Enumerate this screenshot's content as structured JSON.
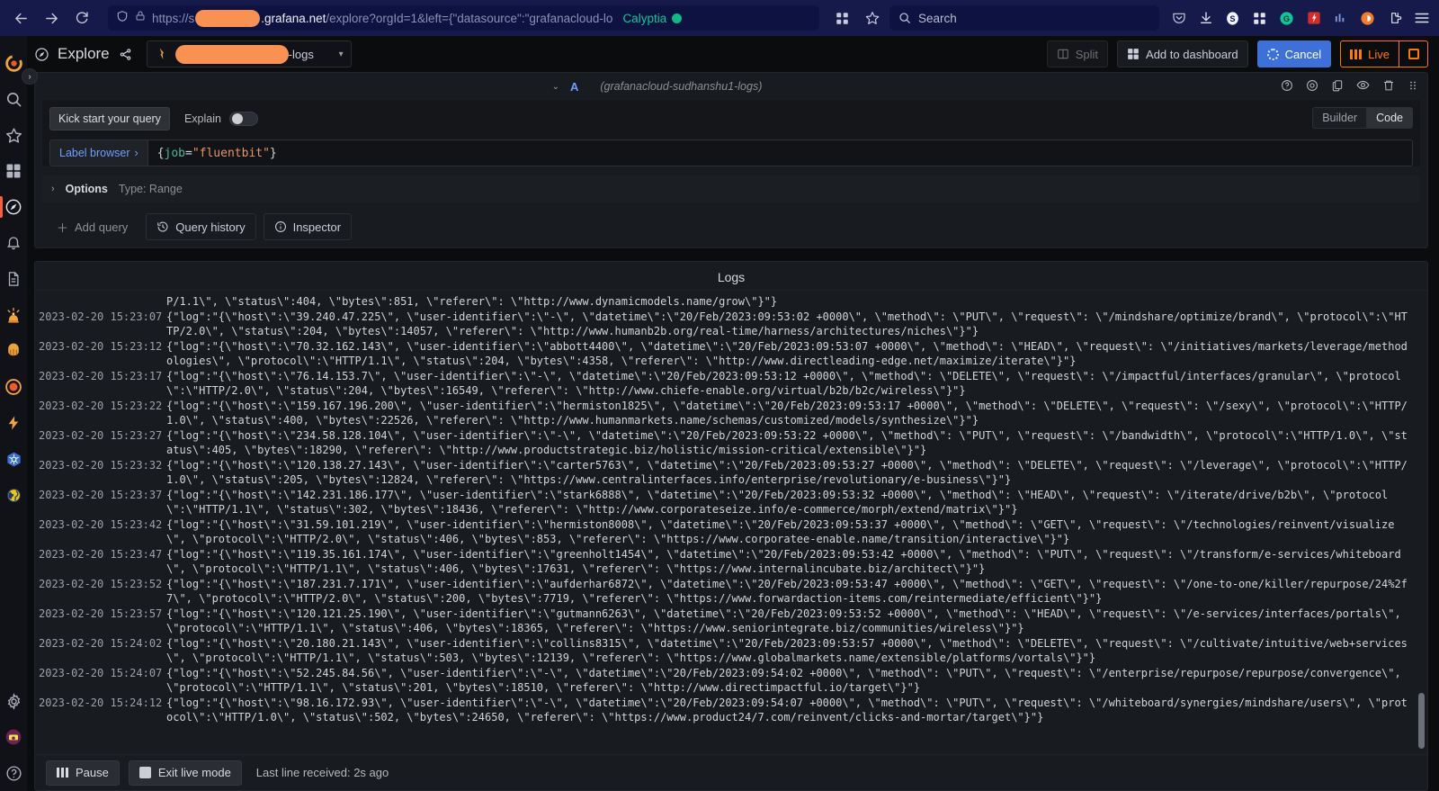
{
  "browser": {
    "url_scheme": "https://s",
    "url_domain": ".grafana.net",
    "url_path": "/explore?orgId=1&left={\"datasource\":\"grafanacloud-lo",
    "profile_label": "Calyptia",
    "search_placeholder": "Search",
    "icons": [
      "back-arrow-icon",
      "forward-arrow-icon",
      "reload-icon",
      "shield-icon",
      "lock-icon",
      "bookmark-star-icon",
      "search-icon"
    ],
    "extensions": [
      "pocket-icon",
      "download-icon",
      "stripe-icon",
      "apps-grid-icon",
      "grammarly-icon",
      "lastpass-icon",
      "metrics-icon",
      "firefox-container-icon",
      "extensions-icon",
      "menu-icon"
    ]
  },
  "sidebar": {
    "items": [
      {
        "name": "grafana-logo-icon",
        "label": "Grafana"
      },
      {
        "name": "search-icon",
        "label": "Search"
      },
      {
        "name": "star-icon",
        "label": "Starred"
      },
      {
        "name": "dashboards-icon",
        "label": "Dashboards"
      },
      {
        "name": "explore-compass-icon",
        "label": "Explore",
        "active": true
      },
      {
        "name": "bell-icon",
        "label": "Alerting"
      },
      {
        "name": "document-icon",
        "label": "Reporting"
      },
      {
        "name": "siren-icon",
        "label": "OnCall"
      },
      {
        "name": "brain-icon",
        "label": "Machine Learning"
      },
      {
        "name": "incident-icon",
        "label": "Incident"
      },
      {
        "name": "lightning-icon",
        "label": "k6 Performance"
      },
      {
        "name": "kubernetes-icon",
        "label": "Kubernetes Monitoring"
      },
      {
        "name": "globe-icon",
        "label": "Synthetic Monitoring"
      }
    ],
    "bottom_items": [
      {
        "name": "gear-icon",
        "label": "Configuration"
      },
      {
        "name": "avatar-icon",
        "label": "Profile"
      },
      {
        "name": "help-icon",
        "label": "Help"
      }
    ],
    "expander_glyph": "›"
  },
  "toolbar": {
    "title": "Explore",
    "share_icon": "share-icon",
    "explore_icon": "compass-icon",
    "datasource_suffix": "-logs",
    "split_label": "Split",
    "add_to_dashboard_label": "Add to dashboard",
    "cancel_label": "Cancel",
    "live_label": "Live"
  },
  "query": {
    "letter": "A",
    "datasource": "(grafanacloud-sudhanshu1-logs)",
    "kick_start_label": "Kick start your query",
    "explain_label": "Explain",
    "builder_label": "Builder",
    "code_label": "Code",
    "label_browser_label": "Label browser",
    "label_browser_chevron": "›",
    "expr_brace_open": "{",
    "expr_key": "job",
    "expr_op": "=",
    "expr_value": "\"fluentbit\"",
    "expr_brace_close": "}",
    "options_chevron": "›",
    "options_label": "Options",
    "options_value": "Type: Range",
    "add_query_label": "Add query",
    "query_history_label": "Query history",
    "inspector_label": "Inspector",
    "row_icons": [
      "help-circle-icon",
      "target-icon",
      "copy-icon",
      "eye-icon",
      "trash-icon",
      "drag-handle-icon"
    ]
  },
  "logs": {
    "title": "Logs",
    "pause_label": "Pause",
    "exit_live_label": "Exit live mode",
    "last_line_label": "Last line received: 2s ago",
    "rows": [
      {
        "ts": "",
        "msg": "P/1.1\\\", \\\"status\\\":404, \\\"bytes\\\":851, \\\"referer\\\": \\\"http://www.dynamicmodels.name/grow\\\"}\"}"
      },
      {
        "ts": "2023-02-20 15:23:07",
        "msg": "{\"log\":\"{\\\"host\\\":\\\"39.240.47.225\\\", \\\"user-identifier\\\":\\\"-\\\", \\\"datetime\\\":\\\"20/Feb/2023:09:53:02 +0000\\\", \\\"method\\\": \\\"PUT\\\", \\\"request\\\": \\\"/mindshare/optimize/brand\\\", \\\"protocol\\\":\\\"HTTP/2.0\\\", \\\"status\\\":204, \\\"bytes\\\":14057, \\\"referer\\\": \\\"http://www.humanb2b.org/real-time/harness/architectures/niches\\\"}\"}"
      },
      {
        "ts": "2023-02-20 15:23:12",
        "msg": "{\"log\":\"{\\\"host\\\":\\\"70.32.162.143\\\", \\\"user-identifier\\\":\\\"abbott4400\\\", \\\"datetime\\\":\\\"20/Feb/2023:09:53:07 +0000\\\", \\\"method\\\": \\\"HEAD\\\", \\\"request\\\": \\\"/initiatives/markets/leverage/methodologies\\\", \\\"protocol\\\":\\\"HTTP/1.1\\\", \\\"status\\\":204, \\\"bytes\\\":4358, \\\"referer\\\": \\\"http://www.directleading-edge.net/maximize/iterate\\\"}\"}"
      },
      {
        "ts": "2023-02-20 15:23:17",
        "msg": "{\"log\":\"{\\\"host\\\":\\\"76.14.153.7\\\", \\\"user-identifier\\\":\\\"-\\\", \\\"datetime\\\":\\\"20/Feb/2023:09:53:12 +0000\\\", \\\"method\\\": \\\"DELETE\\\", \\\"request\\\": \\\"/impactful/interfaces/granular\\\", \\\"protocol\\\":\\\"HTTP/2.0\\\", \\\"status\\\":204, \\\"bytes\\\":16549, \\\"referer\\\": \\\"http://www.chiefe-enable.org/virtual/b2b/b2c/wireless\\\"}\"}"
      },
      {
        "ts": "2023-02-20 15:23:22",
        "msg": "{\"log\":\"{\\\"host\\\":\\\"159.167.196.200\\\", \\\"user-identifier\\\":\\\"hermiston1825\\\", \\\"datetime\\\":\\\"20/Feb/2023:09:53:17 +0000\\\", \\\"method\\\": \\\"DELETE\\\", \\\"request\\\": \\\"/sexy\\\", \\\"protocol\\\":\\\"HTTP/1.0\\\", \\\"status\\\":400, \\\"bytes\\\":22526, \\\"referer\\\": \\\"http://www.humanmarkets.name/schemas/customized/models/synthesize\\\"}\"}"
      },
      {
        "ts": "2023-02-20 15:23:27",
        "msg": "{\"log\":\"{\\\"host\\\":\\\"234.58.128.104\\\", \\\"user-identifier\\\":\\\"-\\\", \\\"datetime\\\":\\\"20/Feb/2023:09:53:22 +0000\\\", \\\"method\\\": \\\"PUT\\\", \\\"request\\\": \\\"/bandwidth\\\", \\\"protocol\\\":\\\"HTTP/1.0\\\", \\\"status\\\":405, \\\"bytes\\\":18290, \\\"referer\\\": \\\"http://www.productstrategic.biz/holistic/mission-critical/extensible\\\"}\"}"
      },
      {
        "ts": "2023-02-20 15:23:32",
        "msg": "{\"log\":\"{\\\"host\\\":\\\"120.138.27.143\\\", \\\"user-identifier\\\":\\\"carter5763\\\", \\\"datetime\\\":\\\"20/Feb/2023:09:53:27 +0000\\\", \\\"method\\\": \\\"DELETE\\\", \\\"request\\\": \\\"/leverage\\\", \\\"protocol\\\":\\\"HTTP/1.0\\\", \\\"status\\\":205, \\\"bytes\\\":12824, \\\"referer\\\": \\\"https://www.centralinterfaces.info/enterprise/revolutionary/e-business\\\"}\"}"
      },
      {
        "ts": "2023-02-20 15:23:37",
        "msg": "{\"log\":\"{\\\"host\\\":\\\"142.231.186.177\\\", \\\"user-identifier\\\":\\\"stark6888\\\", \\\"datetime\\\":\\\"20/Feb/2023:09:53:32 +0000\\\", \\\"method\\\": \\\"HEAD\\\", \\\"request\\\": \\\"/iterate/drive/b2b\\\", \\\"protocol\\\":\\\"HTTP/1.1\\\", \\\"status\\\":302, \\\"bytes\\\":18436, \\\"referer\\\": \\\"http://www.corporateseize.info/e-commerce/morph/extend/matrix\\\"}\"}"
      },
      {
        "ts": "2023-02-20 15:23:42",
        "msg": "{\"log\":\"{\\\"host\\\":\\\"31.59.101.219\\\", \\\"user-identifier\\\":\\\"hermiston8008\\\", \\\"datetime\\\":\\\"20/Feb/2023:09:53:37 +0000\\\", \\\"method\\\": \\\"GET\\\", \\\"request\\\": \\\"/technologies/reinvent/visualize\\\", \\\"protocol\\\":\\\"HTTP/2.0\\\", \\\"status\\\":406, \\\"bytes\\\":853, \\\"referer\\\": \\\"https://www.corporatee-enable.name/transition/interactive\\\"}\"}"
      },
      {
        "ts": "2023-02-20 15:23:47",
        "msg": "{\"log\":\"{\\\"host\\\":\\\"119.35.161.174\\\", \\\"user-identifier\\\":\\\"greenholt1454\\\", \\\"datetime\\\":\\\"20/Feb/2023:09:53:42 +0000\\\", \\\"method\\\": \\\"PUT\\\", \\\"request\\\": \\\"/transform/e-services/whiteboard\\\", \\\"protocol\\\":\\\"HTTP/1.1\\\", \\\"status\\\":406, \\\"bytes\\\":17631, \\\"referer\\\": \\\"https://www.internalincubate.biz/architect\\\"}\"}"
      },
      {
        "ts": "2023-02-20 15:23:52",
        "msg": "{\"log\":\"{\\\"host\\\":\\\"187.231.7.171\\\", \\\"user-identifier\\\":\\\"aufderhar6872\\\", \\\"datetime\\\":\\\"20/Feb/2023:09:53:47 +0000\\\", \\\"method\\\": \\\"GET\\\", \\\"request\\\": \\\"/one-to-one/killer/repurpose/24%2f7\\\", \\\"protocol\\\":\\\"HTTP/2.0\\\", \\\"status\\\":200, \\\"bytes\\\":7719, \\\"referer\\\": \\\"https://www.forwardaction-items.com/reintermediate/efficient\\\"}\"}"
      },
      {
        "ts": "2023-02-20 15:23:57",
        "msg": "{\"log\":\"{\\\"host\\\":\\\"120.121.25.190\\\", \\\"user-identifier\\\":\\\"gutmann6263\\\", \\\"datetime\\\":\\\"20/Feb/2023:09:53:52 +0000\\\", \\\"method\\\": \\\"HEAD\\\", \\\"request\\\": \\\"/e-services/interfaces/portals\\\", \\\"protocol\\\":\\\"HTTP/1.1\\\", \\\"status\\\":406, \\\"bytes\\\":18365, \\\"referer\\\": \\\"https://www.seniorintegrate.biz/communities/wireless\\\"}\"}"
      },
      {
        "ts": "2023-02-20 15:24:02",
        "msg": "{\"log\":\"{\\\"host\\\":\\\"20.180.21.143\\\", \\\"user-identifier\\\":\\\"collins8315\\\", \\\"datetime\\\":\\\"20/Feb/2023:09:53:57 +0000\\\", \\\"method\\\": \\\"DELETE\\\", \\\"request\\\": \\\"/cultivate/intuitive/web+services\\\", \\\"protocol\\\":\\\"HTTP/1.1\\\", \\\"status\\\":503, \\\"bytes\\\":12139, \\\"referer\\\": \\\"https://www.globalmarkets.name/extensible/platforms/vortals\\\"}\"}"
      },
      {
        "ts": "2023-02-20 15:24:07",
        "msg": "{\"log\":\"{\\\"host\\\":\\\"52.245.84.56\\\", \\\"user-identifier\\\":\\\"-\\\", \\\"datetime\\\":\\\"20/Feb/2023:09:54:02 +0000\\\", \\\"method\\\": \\\"PUT\\\", \\\"request\\\": \\\"/enterprise/repurpose/repurpose/convergence\\\", \\\"protocol\\\":\\\"HTTP/1.1\\\", \\\"status\\\":201, \\\"bytes\\\":18510, \\\"referer\\\": \\\"http://www.directimpactful.io/target\\\"}\"}"
      },
      {
        "ts": "2023-02-20 15:24:12",
        "msg": "{\"log\":\"{\\\"host\\\":\\\"98.16.172.93\\\", \\\"user-identifier\\\":\\\"-\\\", \\\"datetime\\\":\\\"20/Feb/2023:09:54:07 +0000\\\", \\\"method\\\": \\\"PUT\\\", \\\"request\\\": \\\"/whiteboard/synergies/mindshare/users\\\", \\\"protocol\\\":\\\"HTTP/1.0\\\", \\\"status\\\":502, \\\"bytes\\\":24650, \\\"referer\\\": \\\"https://www.product24/7.com/reinvent/clicks-and-mortar/target\\\"}\"}"
      }
    ]
  },
  "colors": {
    "accent_orange": "#ff780a",
    "primary_blue": "#3d71d9",
    "link_blue": "#6e9fff",
    "panel_bg": "#181b1f",
    "page_bg": "#0b0c0e",
    "browser_bg": "#161a4a",
    "redaction": "#f99153",
    "calyptia_green": "#12c59a"
  }
}
